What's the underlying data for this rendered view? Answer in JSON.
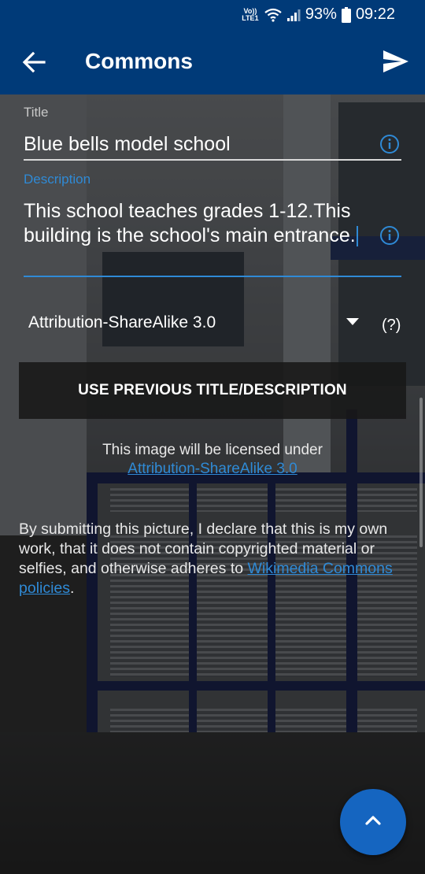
{
  "status_bar": {
    "network": "Vo)) LTE1",
    "battery": "93%",
    "time": "09:22"
  },
  "app_bar": {
    "title": "Commons",
    "back_icon": "arrow-back-icon",
    "send_icon": "send-icon"
  },
  "form": {
    "title_label": "Title",
    "title_value": "Blue bells model school",
    "description_label": "Description",
    "description_value": "This school teaches grades 1-12.This building is the school's main entrance.",
    "license_value": "Attribution-ShareAlike 3.0",
    "license_help": "(?)",
    "info_icon": "info-icon"
  },
  "previous_button_label": "USE PREVIOUS TITLE/DESCRIPTION",
  "license_notice": {
    "text": "This image will be licensed under",
    "link": "Attribution-ShareAlike 3.0"
  },
  "declaration": {
    "text": "By submitting this picture, I declare that this is my own work, that it does not contain copyrighted material or selfies, and otherwise adheres to",
    "link": "Wikimedia Commons policies",
    "suffix": "."
  },
  "fab_icon": "chevron-up-icon",
  "colors": {
    "primary": "#003a78",
    "accent": "#2f8ad6",
    "fab": "#1565c0"
  }
}
